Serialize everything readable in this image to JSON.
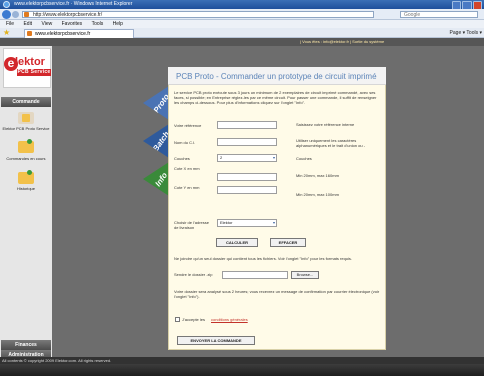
{
  "window": {
    "title": "www.elektorpcbservice.fr · Windows Internet Explorer",
    "address": "http://www.elektorpcbservice.fr/",
    "search_placeholder": "Google",
    "menu": [
      "File",
      "Edit",
      "View",
      "Favorites",
      "Tools",
      "Help"
    ],
    "tab_title": "www.elektorpcbservice.fr",
    "command_bar": "Page ▾  Tools ▾"
  },
  "ticker": {
    "text": "| Vous êtes : info@elektor.fr  |  Sortie du système"
  },
  "brand": {
    "letter": "e",
    "word": "lektor",
    "sub": "PCB Service"
  },
  "sidebar": {
    "header": "Commande",
    "items": [
      {
        "label": "Elektor PCB Proto Service"
      },
      {
        "label": "Commandes en cours"
      },
      {
        "label": "Historique"
      }
    ],
    "bottom": [
      "Finances",
      "Administration"
    ]
  },
  "side_tabs": [
    "Proto",
    "Batch",
    "Info"
  ],
  "form": {
    "title": "PCB Proto - Commander un prototype de circuit imprimé",
    "intro": "Le service PCB proto exécute sous 3 jours un minimum de 2 exemplaires de circuit imprimé commandé, avec ses faces, si possible; en Entreprise réglez-les par ce même circuit. Pour passer une commande, il suffit de renseigner les champs ci-dessous. Pour plus d'informations cliquez sur l'onglet \"Info\".",
    "fields": [
      {
        "label": "Votre référence",
        "value": "",
        "hint": "Saisissez votre référence interne"
      },
      {
        "label": "Nom du C.I.",
        "value": "",
        "hint": "Utiliser uniquement les caractères alphanumériques et le trait d'union ou -"
      },
      {
        "label": "Couches",
        "value": "2",
        "hint": "Couches"
      },
      {
        "label": "Cote X en mm",
        "value": "",
        "hint": "Min 20mm, max 160mm"
      },
      {
        "label": "Cote Y en mm",
        "value": "",
        "hint": "Min 20mm, max 100mm"
      }
    ],
    "delivery": {
      "label": "Choisir de l'adresse de livraison",
      "value": "Elektor"
    },
    "calc_button": "CALCULER",
    "clear_button": "EFFACER",
    "upload_note": "Ne joindre qu'un seul dossier qui contient tous les fichiers. Voir l'onglet \"Info\" pour les formats requis.",
    "upload_label": "Sendre le dossier .zip",
    "browse_button": "Browse...",
    "confirm_note": "Votre dossier sera analysé sous 2 heures; vous recevrez un message de confirmation par courrier électronique (voir l'onglet \"Info\").",
    "accept_text": "J'accepte les",
    "terms_link": "conditions générales",
    "submit_button": "ENVOYER LA COMMANDE"
  },
  "footer": {
    "copyright": "All contents © copyright 2009 Elektor.com. All rights reserved."
  },
  "colors": {
    "brand_red": "#d2272b",
    "title_blue": "#5c84b8",
    "panel_bg": "#fffbe8"
  }
}
